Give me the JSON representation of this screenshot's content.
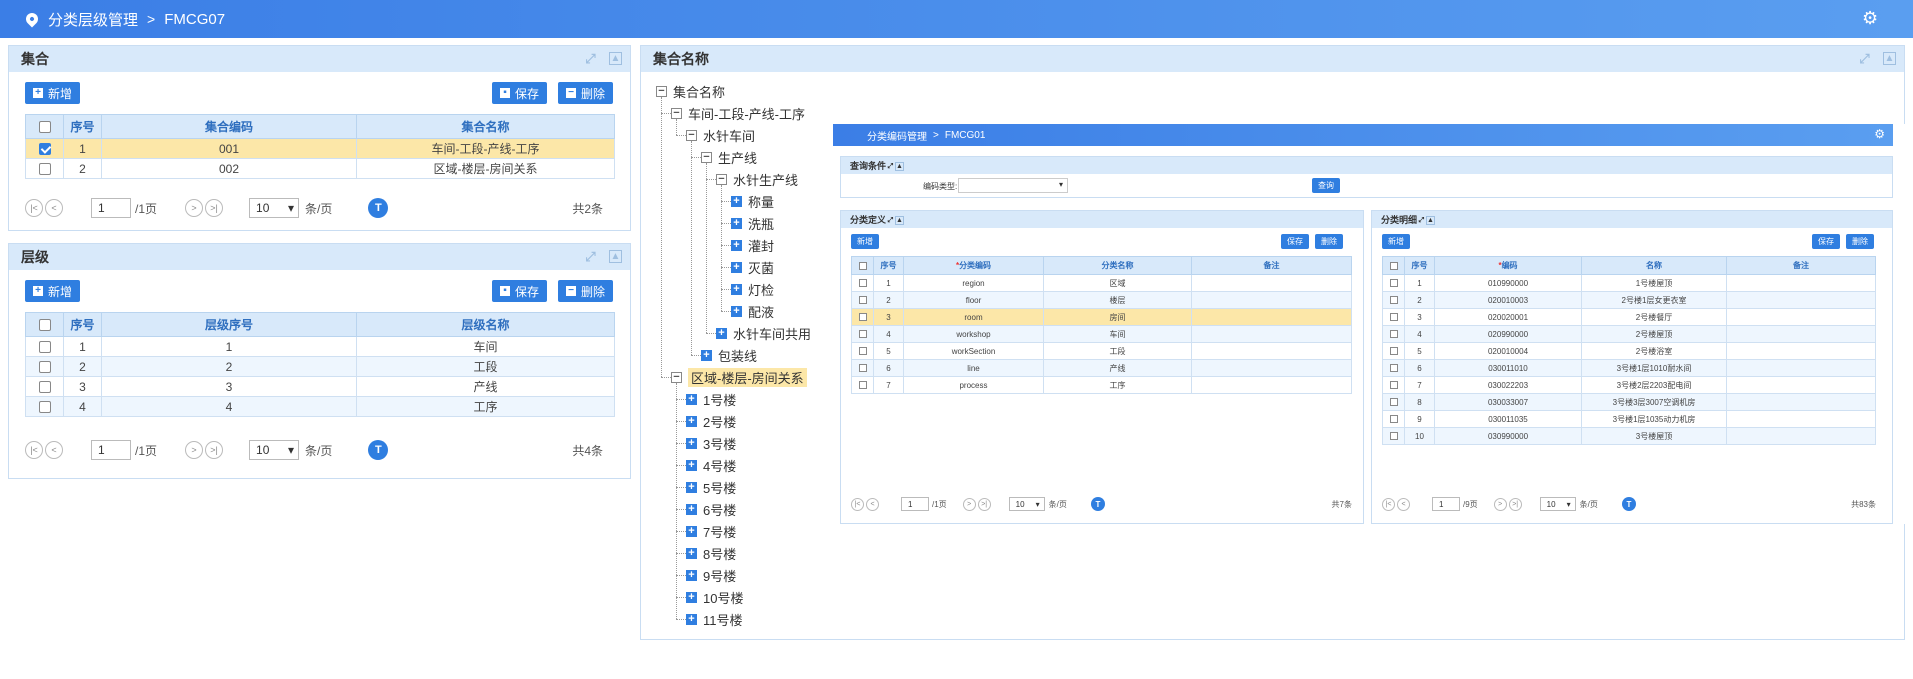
{
  "header": {
    "breadcrumb": [
      "分类层级管理",
      "FMCG07"
    ],
    "icon": "location-pin-icon",
    "settings_icon": "gear-icon"
  },
  "set_panel": {
    "title": "集合",
    "add_label": "新增",
    "save_label": "保存",
    "delete_label": "删除",
    "columns": [
      "序号",
      "集合编码",
      "集合名称"
    ],
    "rows": [
      {
        "no": "1",
        "code": "001",
        "name": "车间-工段-产线-工序",
        "checked": true
      },
      {
        "no": "2",
        "code": "002",
        "name": "区域-楼层-房间关系",
        "checked": false
      }
    ],
    "pager": {
      "page": "1",
      "pages": "/1页",
      "size": "10",
      "size_unit": "条/页",
      "total": "共2条"
    }
  },
  "level_panel": {
    "title": "层级",
    "add_label": "新增",
    "save_label": "保存",
    "delete_label": "删除",
    "columns": [
      "序号",
      "层级序号",
      "层级名称"
    ],
    "rows": [
      {
        "no": "1",
        "seq": "1",
        "name": "车间"
      },
      {
        "no": "2",
        "seq": "2",
        "name": "工段"
      },
      {
        "no": "3",
        "seq": "3",
        "name": "产线"
      },
      {
        "no": "4",
        "seq": "4",
        "name": "工序"
      }
    ],
    "pager": {
      "page": "1",
      "pages": "/1页",
      "size": "10",
      "size_unit": "条/页",
      "total": "共4条"
    }
  },
  "tree_panel": {
    "title": "集合名称",
    "nodes": [
      {
        "label": "集合名称",
        "level": 0,
        "toggle": "minus"
      },
      {
        "label": "车间-工段-产线-工序",
        "level": 1,
        "toggle": "minus"
      },
      {
        "label": "水针车间",
        "level": 2,
        "toggle": "minus"
      },
      {
        "label": "生产线",
        "level": 3,
        "toggle": "minus"
      },
      {
        "label": "水针生产线",
        "level": 4,
        "toggle": "minus"
      },
      {
        "label": "称量",
        "level": 5,
        "toggle": "plus"
      },
      {
        "label": "洗瓶",
        "level": 5,
        "toggle": "plus"
      },
      {
        "label": "灌封",
        "level": 5,
        "toggle": "plus"
      },
      {
        "label": "灭菌",
        "level": 5,
        "toggle": "plus"
      },
      {
        "label": "灯检",
        "level": 5,
        "toggle": "plus"
      },
      {
        "label": "配液",
        "level": 5,
        "toggle": "plus"
      },
      {
        "label": "水针车间共用",
        "level": 4,
        "toggle": "plus"
      },
      {
        "label": "包装线",
        "level": 3,
        "toggle": "plus"
      },
      {
        "label": "区域-楼层-房间关系",
        "level": 1,
        "toggle": "minus",
        "highlight": true
      },
      {
        "label": "1号楼",
        "level": 2,
        "toggle": "plus"
      },
      {
        "label": "2号楼",
        "level": 2,
        "toggle": "plus"
      },
      {
        "label": "3号楼",
        "level": 2,
        "toggle": "plus"
      },
      {
        "label": "4号楼",
        "level": 2,
        "toggle": "plus"
      },
      {
        "label": "5号楼",
        "level": 2,
        "toggle": "plus"
      },
      {
        "label": "6号楼",
        "level": 2,
        "toggle": "plus"
      },
      {
        "label": "7号楼",
        "level": 2,
        "toggle": "plus"
      },
      {
        "label": "8号楼",
        "level": 2,
        "toggle": "plus"
      },
      {
        "label": "9号楼",
        "level": 2,
        "toggle": "plus"
      },
      {
        "label": "10号楼",
        "level": 2,
        "toggle": "plus"
      },
      {
        "label": "11号楼",
        "level": 2,
        "toggle": "plus"
      }
    ]
  },
  "inner": {
    "breadcrumb": [
      "分类编码管理",
      "FMCG01"
    ],
    "query": {
      "title": "查询条件",
      "type_label": "编码类型:",
      "type_value": "",
      "query_label": "查询"
    },
    "def": {
      "title": "分类定义",
      "add_label": "新增",
      "save_label": "保存",
      "delete_label": "删除",
      "columns": [
        "序号",
        "分类编码",
        "分类名称",
        "备注"
      ],
      "rows": [
        {
          "no": "1",
          "code": "region",
          "name": "区域",
          "note": ""
        },
        {
          "no": "2",
          "code": "floor",
          "name": "楼层",
          "note": ""
        },
        {
          "no": "3",
          "code": "room",
          "name": "房间",
          "note": ""
        },
        {
          "no": "4",
          "code": "workshop",
          "name": "车间",
          "note": ""
        },
        {
          "no": "5",
          "code": "workSection",
          "name": "工段",
          "note": ""
        },
        {
          "no": "6",
          "code": "line",
          "name": "产线",
          "note": ""
        },
        {
          "no": "7",
          "code": "process",
          "name": "工序",
          "note": ""
        }
      ],
      "pager": {
        "page": "1",
        "pages": "/1页",
        "size": "10",
        "size_unit": "条/页",
        "total": "共7条"
      }
    },
    "detail": {
      "title": "分类明细",
      "add_label": "新增",
      "save_label": "保存",
      "delete_label": "删除",
      "columns": [
        "序号",
        "编码",
        "名称",
        "备注"
      ],
      "rows": [
        {
          "no": "1",
          "code": "010990000",
          "name": "1号楼屋顶"
        },
        {
          "no": "2",
          "code": "020010003",
          "name": "2号楼1层女更衣室"
        },
        {
          "no": "3",
          "code": "020020001",
          "name": "2号楼餐厅"
        },
        {
          "no": "4",
          "code": "020990000",
          "name": "2号楼屋顶"
        },
        {
          "no": "5",
          "code": "020010004",
          "name": "2号楼浴室"
        },
        {
          "no": "6",
          "code": "030011010",
          "name": "3号楼1层1010耐水间"
        },
        {
          "no": "7",
          "code": "030022203",
          "name": "3号楼2层2203配电间"
        },
        {
          "no": "8",
          "code": "030033007",
          "name": "3号楼3层3007空调机房"
        },
        {
          "no": "9",
          "code": "030011035",
          "name": "3号楼1层1035动力机房"
        },
        {
          "no": "10",
          "code": "030990000",
          "name": "3号楼屋顶"
        }
      ],
      "pager": {
        "page": "1",
        "pages": "/9页",
        "size": "10",
        "size_unit": "条/页",
        "total": "共83条"
      }
    }
  }
}
